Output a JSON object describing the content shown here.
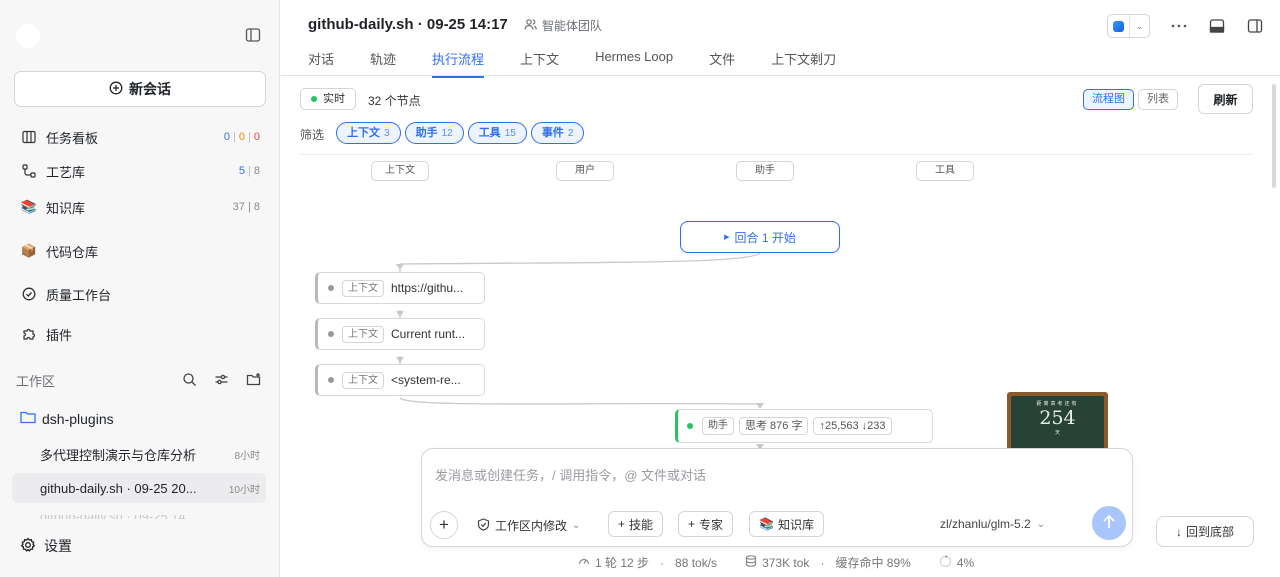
{
  "sidebar": {
    "new_chat_label": "新会话",
    "nav": {
      "board": {
        "label": "任务看板",
        "counts": [
          "0",
          "0",
          "0"
        ]
      },
      "craft": {
        "label": "工艺库",
        "count_a": "5",
        "count_b": "8"
      },
      "knowledge": {
        "label": "知识库",
        "counts": "37 | 8"
      },
      "repo": {
        "label": "代码仓库"
      },
      "quality": {
        "label": "质量工作台"
      },
      "plugins": {
        "label": "插件"
      }
    },
    "workspace_title": "工作区",
    "folder": "dsh-plugins",
    "sessions": [
      {
        "title": "多代理控制演示与仓库分析",
        "time": "8小时"
      },
      {
        "title": "github-daily.sh · 09-25 20...",
        "time": "10小时"
      },
      {
        "title": "github-daily.sh · 09-25 14..."
      }
    ],
    "settings_label": "设置"
  },
  "header": {
    "title": "github-daily.sh · 09-25 14:17",
    "team": "智能体团队",
    "tabs": [
      "对话",
      "轨迹",
      "执行流程",
      "上下文",
      "Hermes Loop",
      "文件",
      "上下文剃刀"
    ],
    "active_tab": "执行流程"
  },
  "toolbar": {
    "live": "实时",
    "node_count": "32 个节点",
    "view_flow": "流程图",
    "view_list": "列表",
    "refresh": "刷新",
    "filter_label": "筛选",
    "chips": [
      {
        "label": "上下文",
        "count": "3"
      },
      {
        "label": "助手",
        "count": "12"
      },
      {
        "label": "工具",
        "count": "15"
      },
      {
        "label": "事件",
        "count": "2"
      }
    ]
  },
  "flow": {
    "lanes": [
      "上下文",
      "用户",
      "助手",
      "工具"
    ],
    "round_start": "回合 1 开始",
    "context_nodes": [
      {
        "tag": "上下文",
        "text": "https://githu..."
      },
      {
        "tag": "上下文",
        "text": "Current runt..."
      },
      {
        "tag": "上下文",
        "text": "<system-re..."
      }
    ],
    "assistant_node": {
      "tag": "助手",
      "thinking": "思考 876 字",
      "tokens": "↑25,563 ↓233"
    }
  },
  "chalkboard": {
    "caption": "距离高考还有",
    "number": "254",
    "unit": "天"
  },
  "composer": {
    "placeholder": "发消息或创建任务，/ 调用指令，@ 文件或对话",
    "mode": "工作区内修改",
    "skill": "技能",
    "expert": "专家",
    "knowledge": "知识库",
    "model": "zl/zhanlu/glm-5.2"
  },
  "back_to_bottom": "回到底部",
  "status": {
    "rounds": "1 轮 12 步",
    "speed": "88 tok/s",
    "tokens": "373K tok",
    "cache": "缓存命中 89%",
    "usage": "4%"
  },
  "colors": {
    "accent": "#2f6fed",
    "live": "#22c55e"
  }
}
